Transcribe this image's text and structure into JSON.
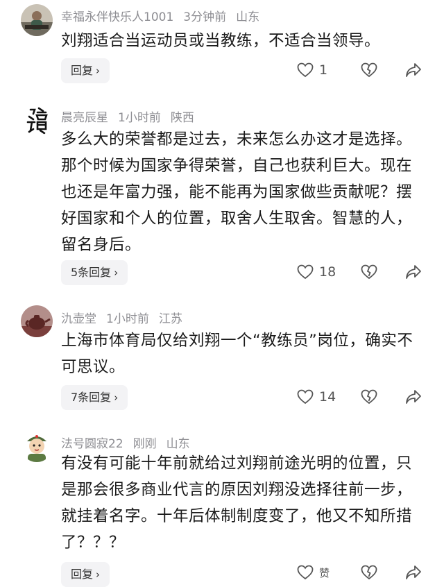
{
  "comments": [
    {
      "user": "幸福永伴快乐人1001",
      "time": "3分钟前",
      "location": "山东",
      "text": "刘翔适合当运动员或当教练，不适合当领导。",
      "reply_label": "回复",
      "likes": "1",
      "avatar_icon": "person-photo"
    },
    {
      "user": "晨亮辰星",
      "time": "1小时前",
      "location": "陕西",
      "text": "多么大的荣誉都是过去，未来怎么办这才是选择。那个时候为国家争得荣誉，自己也获利巨大。现在也还是年富力强，能不能再为国家做些贡献呢？摆好国家和个人的位置，取舍人生取舍。智慧的人，留名身后。",
      "reply_label": "5条回复",
      "likes": "18",
      "avatar_icon": "calligraphy-seal"
    },
    {
      "user": "氿壶堂",
      "time": "1小时前",
      "location": "江苏",
      "text": "上海市体育局仅给刘翔一个“教练员”岗位，确实不可思议。",
      "reply_label": "7条回复",
      "likes": "14",
      "avatar_icon": "teapot-photo"
    },
    {
      "user": "法号圆寂22",
      "time": "刚刚",
      "location": "山东",
      "text": "有没有可能十年前就给过刘翔前途光明的位置，只是那会很多商业代言的原因刘翔没选择往前一步，就挂着名字。十年后体制制度变了，他又不知所措了？？？",
      "reply_label": "回复",
      "likes": "赞",
      "avatar_icon": "cartoon-soldier"
    }
  ],
  "colors": {
    "meta": "#8e8e93",
    "text": "#1a1a1a",
    "button_bg": "#f3f3f5"
  }
}
